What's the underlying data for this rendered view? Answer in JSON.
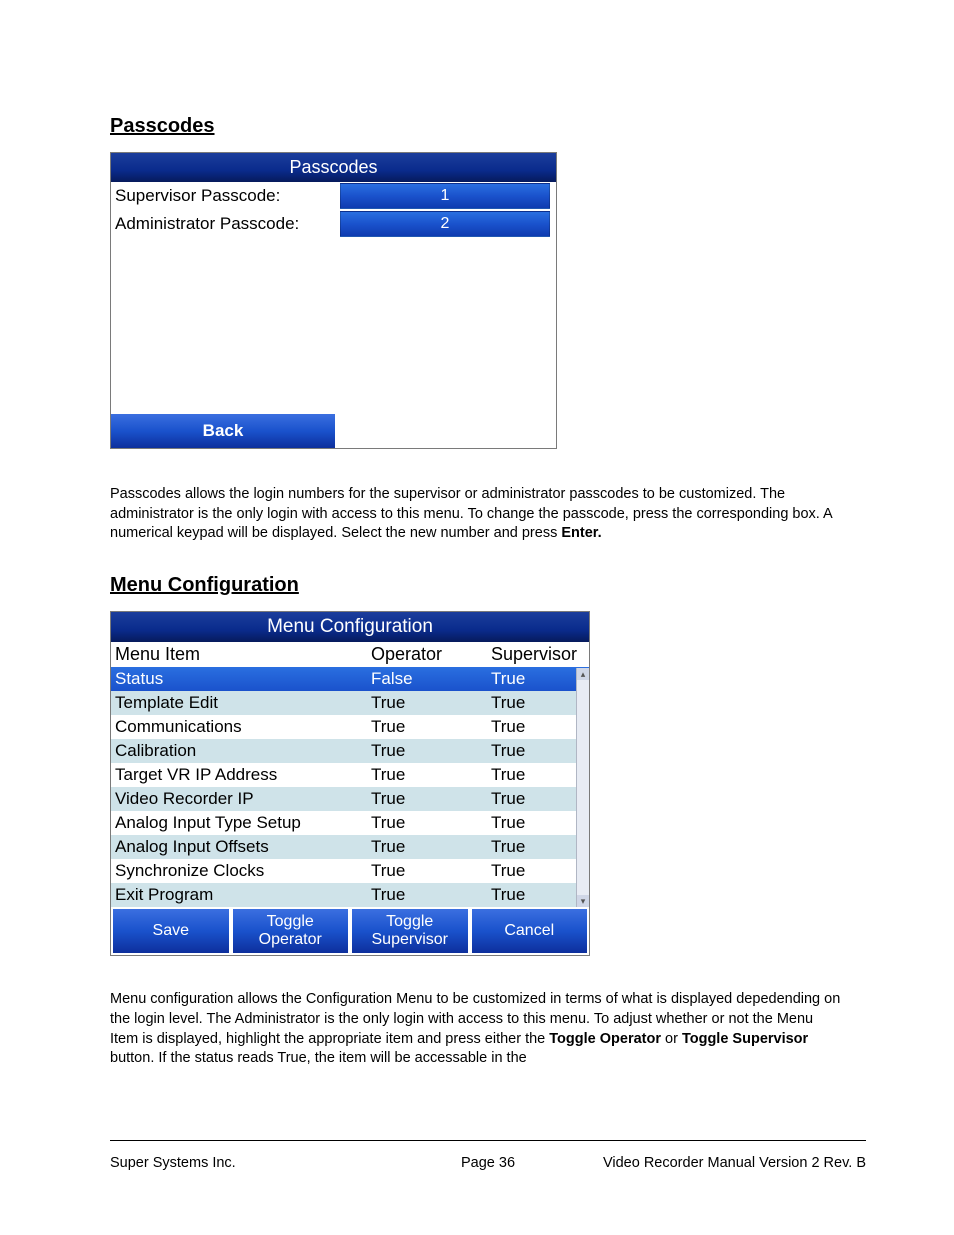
{
  "section1": {
    "heading": "Passcodes",
    "panel_title": "Passcodes",
    "rows": [
      {
        "label": "Supervisor Passcode:",
        "value": "1"
      },
      {
        "label": "Administrator Passcode:",
        "value": "2"
      }
    ],
    "back_label": "Back",
    "para_pre": "Passcodes allows the login numbers for the supervisor or administrator passcodes to be customized.  The administrator is the only login with access to this menu.  To change the passcode, press the corresponding box.  A numerical keypad will be displayed.  Select the new number and press ",
    "para_bold": "Enter."
  },
  "section2": {
    "heading": "Menu Configuration",
    "panel_title": "Menu Configuration",
    "columns": {
      "c1": "Menu Item",
      "c2": "Operator",
      "c3": "Supervisor"
    },
    "rows": [
      {
        "item": "Status",
        "op": "False",
        "sup": "True",
        "cls": "selected"
      },
      {
        "item": "Template Edit",
        "op": "True",
        "sup": "True",
        "cls": "alt"
      },
      {
        "item": "Communications",
        "op": "True",
        "sup": "True",
        "cls": "norm"
      },
      {
        "item": "Calibration",
        "op": "True",
        "sup": "True",
        "cls": "alt"
      },
      {
        "item": "Target VR IP Address",
        "op": "True",
        "sup": "True",
        "cls": "norm"
      },
      {
        "item": "Video Recorder IP",
        "op": "True",
        "sup": "True",
        "cls": "alt"
      },
      {
        "item": "Analog Input Type Setup",
        "op": "True",
        "sup": "True",
        "cls": "norm"
      },
      {
        "item": "Analog Input Offsets",
        "op": "True",
        "sup": "True",
        "cls": "alt"
      },
      {
        "item": "Synchronize Clocks",
        "op": "True",
        "sup": "True",
        "cls": "norm"
      },
      {
        "item": "Exit Program",
        "op": "True",
        "sup": "True",
        "cls": "alt"
      }
    ],
    "buttons": {
      "save": "Save",
      "toggle_op": "Toggle Operator",
      "toggle_sup": "Toggle Supervisor",
      "cancel": "Cancel"
    },
    "para_pre": "Menu configuration allows the Configuration Menu to be customized in terms of what is displayed depedending on the login level.  The Administrator is the only login with access to this menu.  To adjust whether or not the Menu Item is displayed, highlight the appropriate item and press either the ",
    "para_b1": "Toggle Operator",
    "para_mid": " or ",
    "para_b2": "Toggle Supervisor",
    "para_post": " button.  If the status reads True, the item will be accessable in the"
  },
  "footer": {
    "left": "Super Systems Inc.",
    "center": "Page 36",
    "right": "Video Recorder Manual Version 2 Rev. B"
  }
}
